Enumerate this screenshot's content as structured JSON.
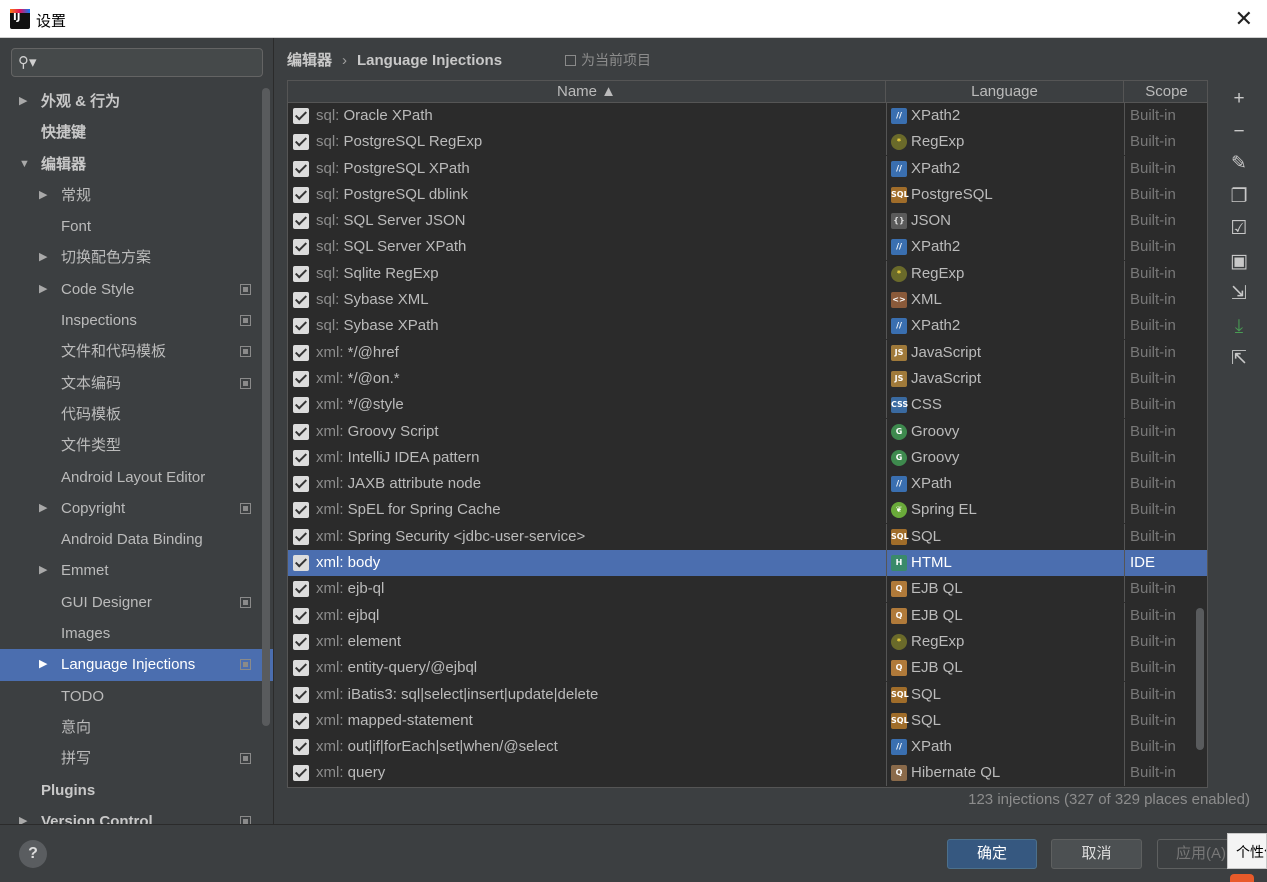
{
  "window": {
    "title": "设置"
  },
  "search": {
    "placeholder": ""
  },
  "sidebar": {
    "items": [
      {
        "label": "外观 & 行为",
        "level": 0,
        "arrow": "▶",
        "bold": true,
        "proj": false
      },
      {
        "label": "快捷键",
        "level": 0,
        "arrow": "",
        "bold": true,
        "proj": false
      },
      {
        "label": "编辑器",
        "level": 0,
        "arrow": "▼",
        "bold": true,
        "proj": false
      },
      {
        "label": "常规",
        "level": 1,
        "arrow": "▶",
        "bold": false,
        "proj": false
      },
      {
        "label": "Font",
        "level": 1,
        "arrow": "",
        "bold": false,
        "proj": false
      },
      {
        "label": "切换配色方案",
        "level": 1,
        "arrow": "▶",
        "bold": false,
        "proj": false
      },
      {
        "label": "Code Style",
        "level": 1,
        "arrow": "▶",
        "bold": false,
        "proj": true
      },
      {
        "label": "Inspections",
        "level": 1,
        "arrow": "",
        "bold": false,
        "proj": true
      },
      {
        "label": "文件和代码模板",
        "level": 1,
        "arrow": "",
        "bold": false,
        "proj": true
      },
      {
        "label": "文本编码",
        "level": 1,
        "arrow": "",
        "bold": false,
        "proj": true
      },
      {
        "label": "代码模板",
        "level": 1,
        "arrow": "",
        "bold": false,
        "proj": false
      },
      {
        "label": "文件类型",
        "level": 1,
        "arrow": "",
        "bold": false,
        "proj": false
      },
      {
        "label": "Android Layout Editor",
        "level": 1,
        "arrow": "",
        "bold": false,
        "proj": false
      },
      {
        "label": "Copyright",
        "level": 1,
        "arrow": "▶",
        "bold": false,
        "proj": true
      },
      {
        "label": "Android Data Binding",
        "level": 1,
        "arrow": "",
        "bold": false,
        "proj": false
      },
      {
        "label": "Emmet",
        "level": 1,
        "arrow": "▶",
        "bold": false,
        "proj": false
      },
      {
        "label": "GUI Designer",
        "level": 1,
        "arrow": "",
        "bold": false,
        "proj": true
      },
      {
        "label": "Images",
        "level": 1,
        "arrow": "",
        "bold": false,
        "proj": false
      },
      {
        "label": "Language Injections",
        "level": 1,
        "arrow": "▶",
        "bold": false,
        "proj": true,
        "selected": true
      },
      {
        "label": "TODO",
        "level": 1,
        "arrow": "",
        "bold": false,
        "proj": false
      },
      {
        "label": "意向",
        "level": 1,
        "arrow": "",
        "bold": false,
        "proj": false
      },
      {
        "label": "拼写",
        "level": 1,
        "arrow": "",
        "bold": false,
        "proj": true
      },
      {
        "label": "Plugins",
        "level": 0,
        "arrow": "",
        "bold": true,
        "proj": false
      },
      {
        "label": "Version Control",
        "level": 0,
        "arrow": "▶",
        "bold": true,
        "proj": true
      }
    ]
  },
  "breadcrumb": {
    "parent": "编辑器",
    "sep": "›",
    "current": "Language Injections"
  },
  "scope_hint": "为当前项目",
  "table": {
    "columns": {
      "name": "Name ▲",
      "language": "Language",
      "scope": "Scope"
    },
    "rows": [
      {
        "prefix": "sql:",
        "name": "Oracle XPath",
        "language": "XPath2",
        "icon": "xpath",
        "glyph": "//",
        "scope": "Built-in"
      },
      {
        "prefix": "sql:",
        "name": "PostgreSQL RegExp",
        "language": "RegExp",
        "icon": "regexp",
        "glyph": "*",
        "scope": "Built-in"
      },
      {
        "prefix": "sql:",
        "name": "PostgreSQL XPath",
        "language": "XPath2",
        "icon": "xpath",
        "glyph": "//",
        "scope": "Built-in"
      },
      {
        "prefix": "sql:",
        "name": "PostgreSQL dblink",
        "language": "PostgreSQL",
        "icon": "sql",
        "glyph": "SQL",
        "scope": "Built-in"
      },
      {
        "prefix": "sql:",
        "name": "SQL Server JSON",
        "language": "JSON",
        "icon": "json",
        "glyph": "{}",
        "scope": "Built-in"
      },
      {
        "prefix": "sql:",
        "name": "SQL Server XPath",
        "language": "XPath2",
        "icon": "xpath",
        "glyph": "//",
        "scope": "Built-in"
      },
      {
        "prefix": "sql:",
        "name": "Sqlite RegExp",
        "language": "RegExp",
        "icon": "regexp",
        "glyph": "*",
        "scope": "Built-in"
      },
      {
        "prefix": "sql:",
        "name": "Sybase XML",
        "language": "XML",
        "icon": "xml",
        "glyph": "<>",
        "scope": "Built-in"
      },
      {
        "prefix": "sql:",
        "name": "Sybase XPath",
        "language": "XPath2",
        "icon": "xpath",
        "glyph": "//",
        "scope": "Built-in"
      },
      {
        "prefix": "xml:",
        "name": "*/@href",
        "language": "JavaScript",
        "icon": "js",
        "glyph": "JS",
        "scope": "Built-in"
      },
      {
        "prefix": "xml:",
        "name": "*/@on.*",
        "language": "JavaScript",
        "icon": "js",
        "glyph": "JS",
        "scope": "Built-in"
      },
      {
        "prefix": "xml:",
        "name": "*/@style",
        "language": "CSS",
        "icon": "css",
        "glyph": "CSS",
        "scope": "Built-in"
      },
      {
        "prefix": "xml:",
        "name": "Groovy Script",
        "language": "Groovy",
        "icon": "groovy",
        "glyph": "G",
        "scope": "Built-in"
      },
      {
        "prefix": "xml:",
        "name": "IntelliJ IDEA pattern",
        "language": "Groovy",
        "icon": "groovy",
        "glyph": "G",
        "scope": "Built-in"
      },
      {
        "prefix": "xml:",
        "name": "JAXB attribute node",
        "language": "XPath",
        "icon": "xpath",
        "glyph": "//",
        "scope": "Built-in"
      },
      {
        "prefix": "xml:",
        "name": "SpEL for Spring Cache",
        "language": "Spring EL",
        "icon": "spring",
        "glyph": "❦",
        "scope": "Built-in"
      },
      {
        "prefix": "xml:",
        "name": "Spring Security <jdbc-user-service>",
        "language": "SQL",
        "icon": "sql",
        "glyph": "SQL",
        "scope": "Built-in"
      },
      {
        "prefix": "xml:",
        "name": "body",
        "language": "HTML",
        "icon": "html",
        "glyph": "H",
        "scope": "IDE",
        "selected": true
      },
      {
        "prefix": "xml:",
        "name": "ejb-ql",
        "language": "EJB QL",
        "icon": "ejb",
        "glyph": "Q",
        "scope": "Built-in"
      },
      {
        "prefix": "xml:",
        "name": "ejbql",
        "language": "EJB QL",
        "icon": "ejb",
        "glyph": "Q",
        "scope": "Built-in"
      },
      {
        "prefix": "xml:",
        "name": "element",
        "language": "RegExp",
        "icon": "regexp",
        "glyph": "*",
        "scope": "Built-in"
      },
      {
        "prefix": "xml:",
        "name": "entity-query/@ejbql",
        "language": "EJB QL",
        "icon": "ejb",
        "glyph": "Q",
        "scope": "Built-in"
      },
      {
        "prefix": "xml:",
        "name": "iBatis3: sql|select|insert|update|delete",
        "language": "SQL",
        "icon": "sql",
        "glyph": "SQL",
        "scope": "Built-in"
      },
      {
        "prefix": "xml:",
        "name": "mapped-statement",
        "language": "SQL",
        "icon": "sql",
        "glyph": "SQL",
        "scope": "Built-in"
      },
      {
        "prefix": "xml:",
        "name": "out|if|forEach|set|when/@select",
        "language": "XPath",
        "icon": "xpath",
        "glyph": "//",
        "scope": "Built-in"
      },
      {
        "prefix": "xml:",
        "name": "query",
        "language": "Hibernate QL",
        "icon": "hql",
        "glyph": "Q",
        "scope": "Built-in"
      }
    ]
  },
  "toolbar": [
    {
      "name": "add-icon",
      "glyph": "+"
    },
    {
      "name": "remove-icon",
      "glyph": "−"
    },
    {
      "name": "edit-icon",
      "glyph": "✎"
    },
    {
      "name": "copy-icon",
      "glyph": "❐"
    },
    {
      "name": "enable-selected-icon",
      "glyph": "☑"
    },
    {
      "name": "toggle-scope-icon",
      "glyph": "▣"
    },
    {
      "name": "import-icon",
      "glyph": "⇲"
    },
    {
      "name": "download-icon",
      "glyph": "⤓",
      "green": true
    },
    {
      "name": "export-icon",
      "glyph": "⇱"
    }
  ],
  "status": "123 injections (327 of 329 places enabled)",
  "footer": {
    "help": "?",
    "ok": "确定",
    "cancel": "取消",
    "apply": "应用(A)",
    "tooltip": "个性化"
  }
}
